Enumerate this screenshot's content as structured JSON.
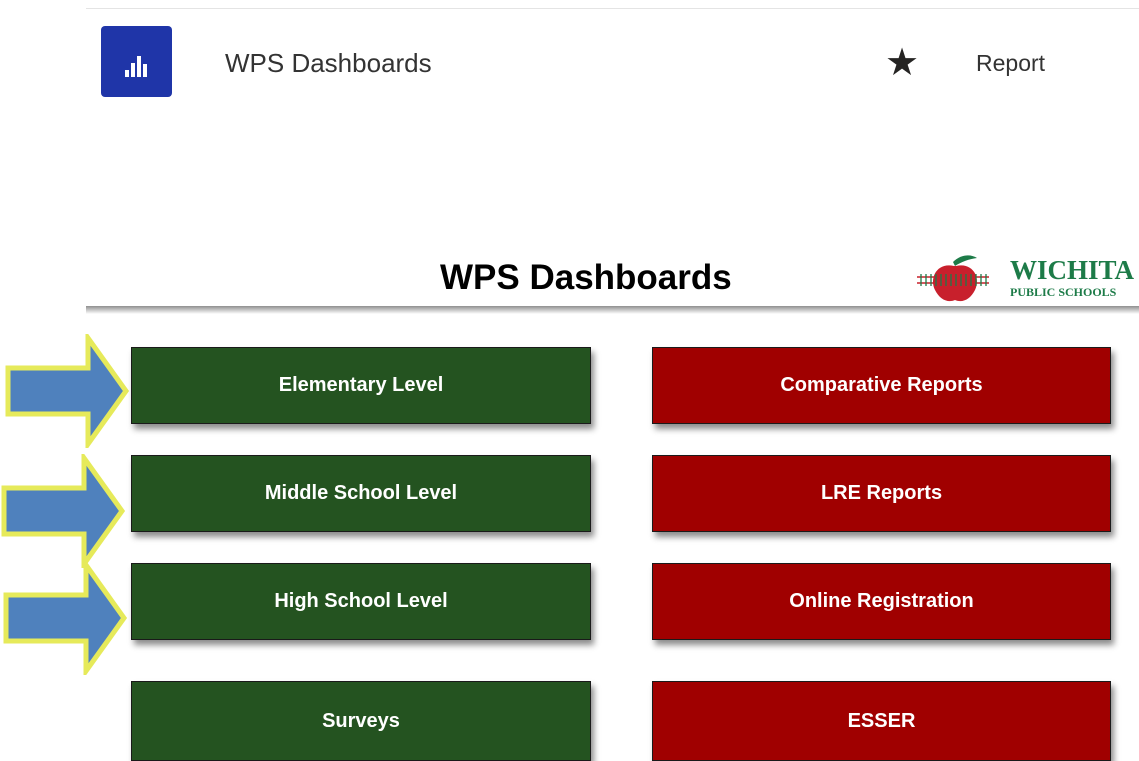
{
  "header": {
    "app_title": "WPS Dashboards",
    "favorite_icon": "star-icon",
    "report_label": "Report",
    "app_icon": "bar-chart-icon"
  },
  "report": {
    "title": "WPS Dashboards",
    "logo_name": "WICHITA",
    "logo_sub": "PUBLIC SCHOOLS"
  },
  "buttons": {
    "green": [
      "Elementary Level",
      "Middle School Level",
      "High School Level",
      "Surveys"
    ],
    "red": [
      "Comparative Reports",
      "LRE Reports",
      "Online Registration",
      "ESSER"
    ]
  },
  "colors": {
    "app_tile": "#1f35a8",
    "green_button": "#245320",
    "red_button": "#a00000",
    "arrow_fill": "#4f81bd",
    "arrow_outline": "#e6ea5a",
    "logo_green": "#1d7b48",
    "apple_red": "#c8202c"
  }
}
